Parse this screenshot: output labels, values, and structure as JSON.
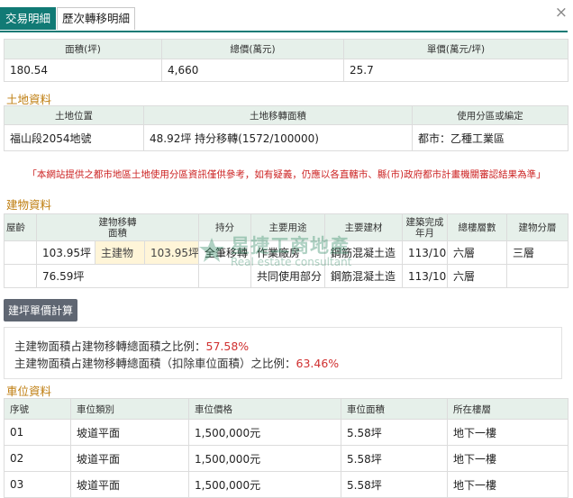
{
  "close_icon": "close-icon",
  "tabs": [
    {
      "label": "交易明細",
      "active": true
    },
    {
      "label": "歷次轉移明細",
      "active": false
    }
  ],
  "price": {
    "headers": [
      "面積(坪)",
      "總價(萬元)",
      "單價(萬元/坪)"
    ],
    "values": [
      "180.54",
      "4,660",
      "25.7"
    ]
  },
  "land": {
    "title": "土地資料",
    "headers": [
      "土地位置",
      "土地移轉面積",
      "使用分區或編定"
    ],
    "row": [
      "福山段2054地號",
      "48.92坪 持分移轉(1572/100000)",
      "都市：乙種工業區"
    ]
  },
  "notice": "「本網站提供之都市地區土地使用分區資訊僅供參考，如有疑義，仍應以各直轄市、縣(市)政府都市計畫機關審認結果為準」",
  "building": {
    "title": "建物資料",
    "headers": {
      "floor_age": "屋齡",
      "transfer_area": "建物移轉面積",
      "share": "持分",
      "main_use": "主要用途",
      "main_material": "主要建材",
      "completed": "建築完成年月",
      "total_floors": "總樓層數",
      "floor": "建物分層"
    },
    "rows": [
      {
        "age": "",
        "area": "103.95坪",
        "tag": "主建物",
        "tag_area": "103.95坪",
        "share": "全筆移轉",
        "use": "作業廠房",
        "material": "鋼筋混凝土造",
        "completed": "113/10",
        "total_floors": "六層",
        "floor": "三層"
      },
      {
        "age": "",
        "area": "76.59坪",
        "tag": "",
        "tag_area": "",
        "share": "",
        "use": "共同使用部分",
        "material": "鋼筋混凝土造",
        "completed": "113/10",
        "total_floors": "六層",
        "floor": ""
      }
    ]
  },
  "calc_button": "建坪單價計算",
  "ratios": [
    {
      "label": "主建物面積占建物移轉總面積之比例：",
      "value": "57.58%"
    },
    {
      "label": "主建物面積占建物移轉總面積（扣除車位面積）之比例：",
      "value": "63.46%"
    }
  ],
  "parking": {
    "title": "車位資料",
    "headers": [
      "序號",
      "車位類別",
      "車位價格",
      "車位面積",
      "所在樓層"
    ],
    "rows": [
      [
        "01",
        "坡道平面",
        "1,500,000元",
        "5.58坪",
        "地下一樓"
      ],
      [
        "02",
        "坡道平面",
        "1,500,000元",
        "5.58坪",
        "地下一樓"
      ],
      [
        "03",
        "坡道平面",
        "1,500,000元",
        "5.58坪",
        "地下一樓"
      ]
    ]
  },
  "watermark": {
    "cn": "星捷工商地產",
    "en": "Real estate consultant"
  },
  "colors": {
    "tab_active": "#117a75",
    "section_title": "#bf7e10",
    "notice": "#cc2222",
    "ratio_value": "#d03030"
  }
}
